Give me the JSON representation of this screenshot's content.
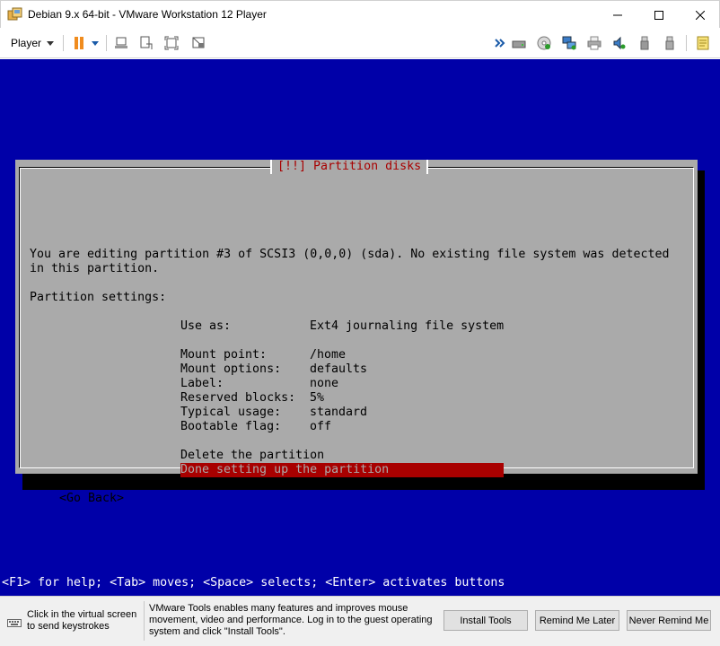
{
  "window": {
    "title": "Debian 9.x 64-bit - VMware Workstation 12 Player",
    "minimize_glyph": "—",
    "maximize_glyph": "☐",
    "close_glyph": "✕"
  },
  "toolbar": {
    "player_label": "Player",
    "icons": [
      "pause-icon",
      "send-ctrl-alt-del-icon",
      "fit-guest-icon",
      "full-screen-icon",
      "unity-icon",
      "show-devices-icon",
      "hard-disk-icon",
      "cd-dvd-icon",
      "network-adapter-icon",
      "printer-icon",
      "sound-card-icon",
      "usb-controller-icon",
      "usb-device-icon",
      "message-log-icon"
    ]
  },
  "installer": {
    "dialog_title": "[!!] Partition disks",
    "intro_line1": "You are editing partition #3 of SCSI3 (0,0,0) (sda). No existing file system was detected",
    "intro_line2": "in this partition.",
    "settings_heading": "Partition settings:",
    "settings": [
      {
        "label": "Use as:",
        "value": "Ext4 journaling file system"
      },
      {
        "label": "Mount point:",
        "value": "/home"
      },
      {
        "label": "Mount options:",
        "value": "defaults"
      },
      {
        "label": "Label:",
        "value": "none"
      },
      {
        "label": "Reserved blocks:",
        "value": "5%"
      },
      {
        "label": "Typical usage:",
        "value": "standard"
      },
      {
        "label": "Bootable flag:",
        "value": "off"
      }
    ],
    "delete_option": "Delete the partition",
    "done_option": "Done setting up the partition",
    "go_back": "<Go Back>",
    "help_line": "<F1> for help; <Tab> moves; <Space> selects; <Enter> activates buttons"
  },
  "notification": {
    "hint": "Click in the virtual screen to send keystrokes",
    "message": "VMware Tools enables many features and improves mouse movement, video and performance. Log in to the guest operating system and click \"Install Tools\".",
    "install_button": "Install Tools",
    "remind_button": "Remind Me Later",
    "never_button": "Never Remind Me"
  },
  "colors": {
    "vm_background": "#0000a8",
    "dialog_background": "#aaaaaa",
    "dialog_title": "#a80000",
    "selection": "#a80000",
    "pause_accent": "#f08c1e"
  }
}
